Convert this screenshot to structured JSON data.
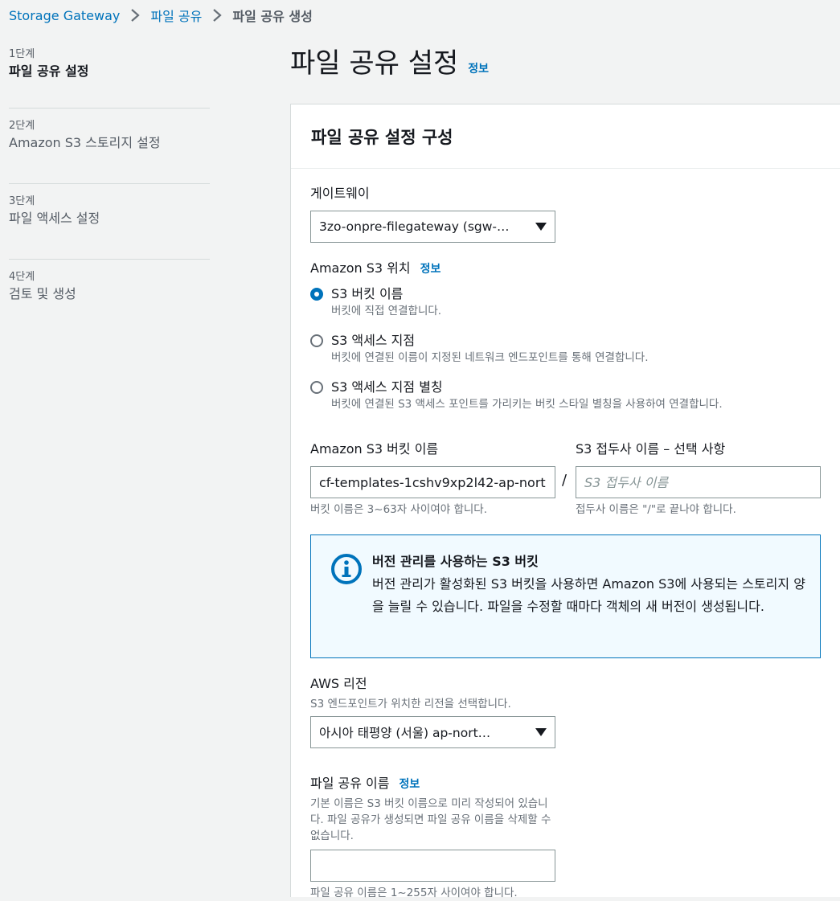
{
  "breadcrumb": {
    "items": [
      "Storage Gateway",
      "파일 공유"
    ],
    "current": "파일 공유 생성"
  },
  "steps": [
    {
      "num": "1단계",
      "title": "파일 공유 설정"
    },
    {
      "num": "2단계",
      "title": "Amazon S3 스토리지 설정"
    },
    {
      "num": "3단계",
      "title": "파일 액세스 설정"
    },
    {
      "num": "4단계",
      "title": "검토 및 생성"
    }
  ],
  "page": {
    "title": "파일 공유 설정",
    "info": "정보"
  },
  "panel": {
    "title": "파일 공유 설정 구성"
  },
  "gateway": {
    "label": "게이트웨이",
    "value": "3zo-onpre-filegateway (sgw-…"
  },
  "s3_location": {
    "label": "Amazon S3 위치",
    "info": "정보",
    "options": [
      {
        "label": "S3 버킷 이름",
        "desc": "버킷에 직접 연결합니다.",
        "selected": true
      },
      {
        "label": "S3 액세스 지점",
        "desc": "버킷에 연결된 이름이 지정된 네트워크 엔드포인트를 통해 연결합니다.",
        "selected": false
      },
      {
        "label": "S3 액세스 지점 별칭",
        "desc": "버킷에 연결된 S3 액세스 포인트를 가리키는 버킷 스타일 별칭을 사용하여 연결합니다.",
        "selected": false
      }
    ]
  },
  "bucket": {
    "label": "Amazon S3 버킷 이름",
    "value": "cf-templates-1cshv9xp2l42-ap-nort",
    "hint": "버킷 이름은 3~63자 사이여야 합니다."
  },
  "separator": "/",
  "prefix": {
    "label": "S3 접두사 이름 – 선택 사항",
    "placeholder": "S3 접두사 이름",
    "hint": "접두사 이름은 \"/\"로 끝나야 합니다."
  },
  "alert": {
    "title": "버전 관리를 사용하는 S3 버킷",
    "body": "버전 관리가 활성화된 S3 버킷을 사용하면 Amazon S3에 사용되는 스토리지 양을 늘릴 수 있습니다. 파일을 수정할 때마다 객체의 새 버전이 생성됩니다."
  },
  "region": {
    "label": "AWS 리전",
    "desc": "S3 엔드포인트가 위치한 리전을 선택합니다.",
    "value": "아시아 태평양 (서울) ap-nort…"
  },
  "share_name": {
    "label": "파일 공유 이름",
    "info": "정보",
    "desc": "기본 이름은 S3 버킷 이름으로 미리 작성되어 있습니다. 파일 공유가 생성되면 파일 공유 이름을 삭제할 수 없습니다.",
    "value": "",
    "hint": "파일 공유 이름은 1~255자 사이여야 합니다."
  },
  "colors": {
    "link": "#0073bb",
    "selected_radio": "#0073bb",
    "alert_bg": "#f1faff"
  }
}
